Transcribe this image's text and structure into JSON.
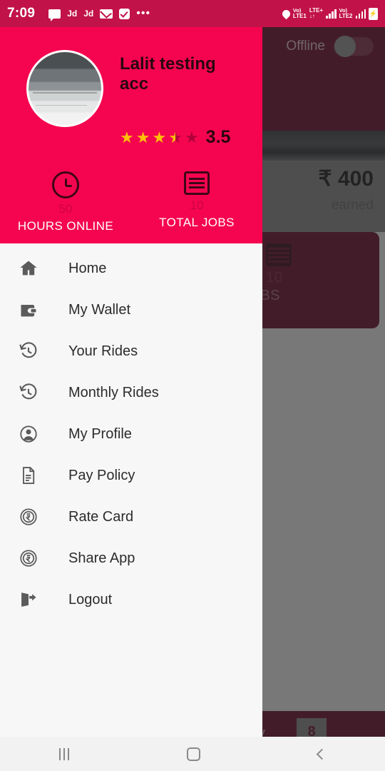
{
  "status_bar": {
    "time": "7:09",
    "app_badge_1": "Jd",
    "app_badge_2": "Jd",
    "dots": "•••",
    "network_1_line1": "Vo)",
    "network_1_line2": "LTE1",
    "network_2_line1": "LTE+",
    "network_2_line2": "↓↑",
    "network_3_line1": "Vo)",
    "network_3_line2": "LTE2",
    "icons": [
      "location-icon",
      "chat-icon",
      "mail-icon",
      "checkbox-icon",
      "signal-icon",
      "battery-icon"
    ],
    "background_color": "#c2124a"
  },
  "drawer": {
    "accent_color": "#f5054f",
    "profile": {
      "name": "Lalit testing acc",
      "rating_value": "3.5",
      "stars": [
        "full",
        "full",
        "full",
        "half",
        "empty"
      ],
      "avatar_alt": "profile-photo"
    },
    "stats": [
      {
        "icon": "clock-icon",
        "value": "50",
        "label": "HOURS ONLINE"
      },
      {
        "icon": "list-icon",
        "value": "10",
        "label": "TOTAL JOBS"
      }
    ],
    "menu": [
      {
        "label": "Home",
        "icon": "home-icon"
      },
      {
        "label": "My Wallet",
        "icon": "wallet-icon"
      },
      {
        "label": "Your Rides",
        "icon": "history-icon"
      },
      {
        "label": "Monthly Rides",
        "icon": "history-icon"
      },
      {
        "label": "My Profile",
        "icon": "person-icon"
      },
      {
        "label": "Pay Policy",
        "icon": "document-icon"
      },
      {
        "label": "Rate Card",
        "icon": "rupee-circle-icon"
      },
      {
        "label": "Share App",
        "icon": "rupee-circle-icon"
      },
      {
        "label": "Logout",
        "icon": "logout-icon"
      }
    ]
  },
  "background_app": {
    "offline_label": "Offline",
    "offline_toggle_state": "off",
    "earnings_amount": "₹ 400",
    "earnings_sub": "earned",
    "card_value": "10",
    "card_label": "AL JOBS",
    "bottom_text": "y",
    "bottom_badge": "8",
    "maroon_color": "#6d0b2c"
  },
  "nav_bar": {
    "recents_label": "recents-button",
    "home_label": "home-button",
    "back_label": "back-button"
  }
}
